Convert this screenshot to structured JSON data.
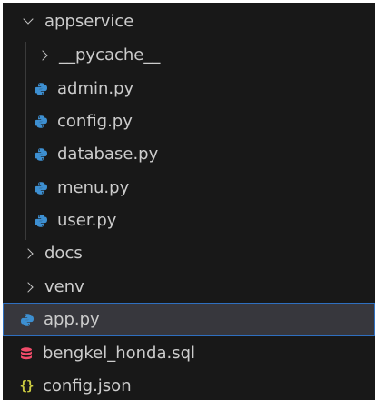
{
  "tree": {
    "folder_appservice": {
      "label": "appservice",
      "expanded": true
    },
    "folder_pycache": {
      "label": "__pycache__",
      "expanded": false
    },
    "file_admin": {
      "label": "admin.py",
      "icon": "python-icon"
    },
    "file_config_py": {
      "label": "config.py",
      "icon": "python-icon"
    },
    "file_database": {
      "label": "database.py",
      "icon": "python-icon"
    },
    "file_menu": {
      "label": "menu.py",
      "icon": "python-icon"
    },
    "file_user": {
      "label": "user.py",
      "icon": "python-icon"
    },
    "folder_docs": {
      "label": "docs",
      "expanded": false
    },
    "folder_venv": {
      "label": "venv",
      "expanded": false
    },
    "file_app": {
      "label": "app.py",
      "icon": "python-icon",
      "selected": true
    },
    "file_sql": {
      "label": "bengkel_honda.sql",
      "icon": "database-icon"
    },
    "file_json": {
      "label": "config.json",
      "icon": "json-icon",
      "icon_text": "{}"
    }
  },
  "colors": {
    "background": "#181818",
    "selected_background": "#37373d",
    "selected_border": "#2f6fbf",
    "text": "#cccccc",
    "python_icon": "#3d8fd1",
    "database_icon": "#f14c6a",
    "json_icon": "#cbcb41"
  }
}
